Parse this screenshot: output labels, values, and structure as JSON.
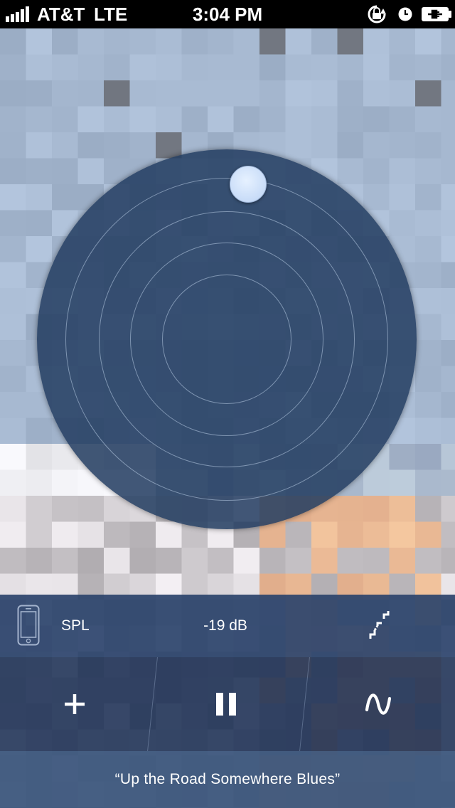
{
  "status_bar": {
    "carrier": "AT&T",
    "network": "LTE",
    "time": "3:04 PM",
    "icons": [
      "signal-icon",
      "rotation-lock-icon",
      "alarm-icon",
      "battery-charging-icon"
    ]
  },
  "meter": {
    "mode_label": "SPL",
    "level": "-19 dB",
    "left_icon": "phone-icon",
    "right_icon": "scale-icon"
  },
  "transport": {
    "buttons": [
      "add-icon",
      "pause-icon",
      "waveform-icon"
    ]
  },
  "now_playing": {
    "title": "“Up the Road Somewhere Blues”"
  },
  "colors": {
    "radar": "#233c61",
    "knob": "#d3e4fb",
    "meter_bar": "#2b436b",
    "transport_bar": "#1c3054",
    "title_bar": "#3c567c"
  }
}
